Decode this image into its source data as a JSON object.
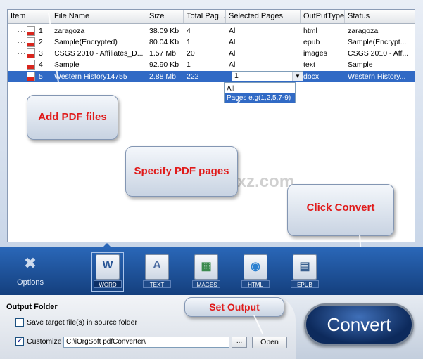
{
  "columns": [
    "Item",
    "File Name",
    "Size",
    "Total Pag...",
    "Selected Pages",
    "OutPutType",
    "Status"
  ],
  "files": [
    {
      "item": "1",
      "name": "zaragoza",
      "size": "38.09 Kb",
      "total": "4",
      "selected": "All",
      "type": "html",
      "status": "zaragoza"
    },
    {
      "item": "2",
      "name": "Sample(Encrypted)",
      "size": "80.04 Kb",
      "total": "1",
      "selected": "All",
      "type": "epub",
      "status": "Sample(Encrypt..."
    },
    {
      "item": "3",
      "name": "CSGS 2010 - Affiliates_D...",
      "size": "1.57 Mb",
      "total": "20",
      "selected": "All",
      "type": "images",
      "status": "CSGS 2010 - Aff..."
    },
    {
      "item": "4",
      "name": "Sample",
      "size": "92.90 Kb",
      "total": "1",
      "selected": "All",
      "type": "text",
      "status": "Sample"
    },
    {
      "item": "5",
      "name": "Western History14755",
      "size": "2.88 Mb",
      "total": "222",
      "selected": "1",
      "type": "docx",
      "status": "Western History..."
    }
  ],
  "pages_dropdown": {
    "options": [
      "All",
      "Pages e.g(1,2,5,7-9)"
    ],
    "highlighted_index": 1
  },
  "callouts": {
    "add_pdf": "Add PDF files",
    "specify_pages": "Specify PDF pages",
    "click_convert": "Click Convert",
    "set_output": "Set Output"
  },
  "watermark": "安下载 anxz.com",
  "options_label": "Options",
  "formats": [
    {
      "label": "WORD",
      "glyph": "W",
      "color": "#2b5797",
      "active": true
    },
    {
      "label": "TEXT",
      "glyph": "A",
      "color": "#4a6aa0",
      "active": false
    },
    {
      "label": "IMAGES",
      "glyph": "▦",
      "color": "#3b8a4e",
      "active": false
    },
    {
      "label": "HTML",
      "glyph": "◉",
      "color": "#2a7fd0",
      "active": false
    },
    {
      "label": "EPUB",
      "glyph": "▤",
      "color": "#3a5f8f",
      "active": false
    }
  ],
  "output": {
    "title": "Output Folder",
    "save_source_label": "Save target file(s) in source folder",
    "save_source_checked": false,
    "customize_label": "Customize",
    "customize_checked": true,
    "path": "C:\\iOrgSoft  pdfConverter\\",
    "browse_label": "...",
    "open_label": "Open"
  },
  "convert_label": "Convert",
  "colors": {
    "accent_blue": "#1b4f96",
    "selection": "#316ac5",
    "callout_text": "#e01b1b"
  }
}
